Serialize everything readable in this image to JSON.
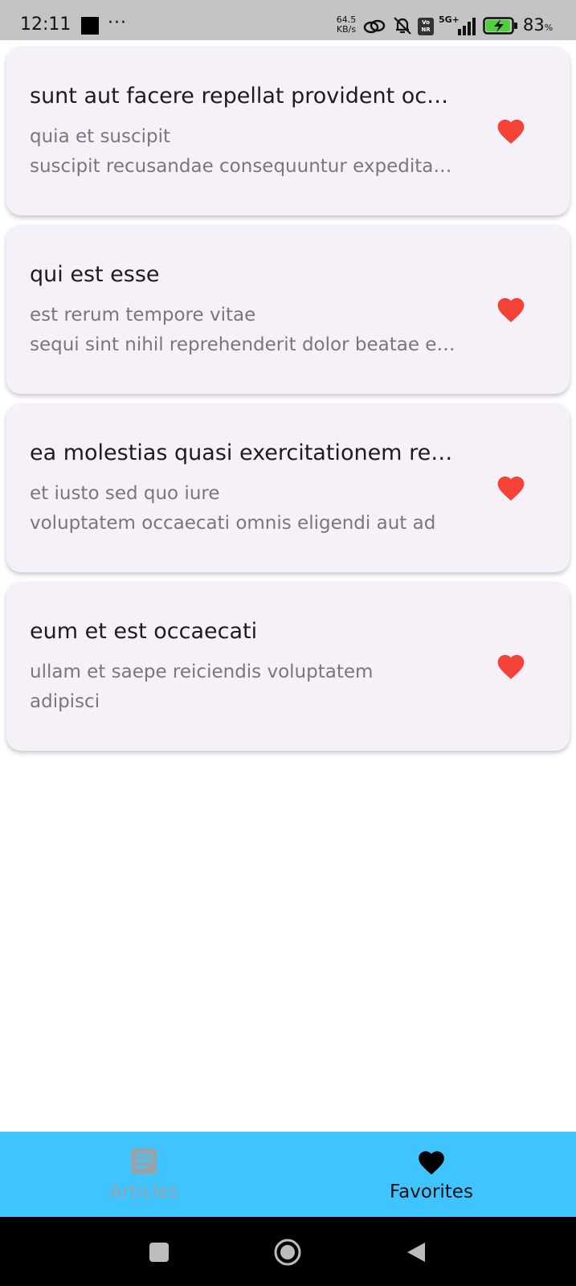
{
  "status_bar": {
    "time": "12:11",
    "more": "···",
    "speed_value": "64.5",
    "speed_unit": "KB/s",
    "vonr": "Vo NR",
    "network": "5G+",
    "battery_percent": "83",
    "battery_unit": "%"
  },
  "articles": [
    {
      "title": "sunt aut facere repellat provident occaecati excepturi optio reprehenderit",
      "line1": "quia et suscipit",
      "line2": "suscipit recusandae consequuntur expedita et cum"
    },
    {
      "title": "qui est esse",
      "line1": "est rerum tempore vitae",
      "line2": "sequi sint nihil reprehenderit dolor beatae ea dolores neque"
    },
    {
      "title": "ea molestias quasi exercitationem repellat qui ipsa sit aut",
      "line1": "et iusto sed quo iure",
      "line2": "voluptatem occaecati omnis eligendi aut ad"
    },
    {
      "title": "eum et est occaecati",
      "line1": "ullam et saepe reiciendis voluptatem",
      "line2": "adipisci"
    }
  ],
  "bottom_nav": {
    "articles_label": "Articles",
    "favorites_label": "Favorites",
    "selected": "favorites"
  },
  "colors": {
    "heart": "#f44336",
    "nav_bg": "#40c4ff",
    "card_bg": "#f6f1f8"
  }
}
